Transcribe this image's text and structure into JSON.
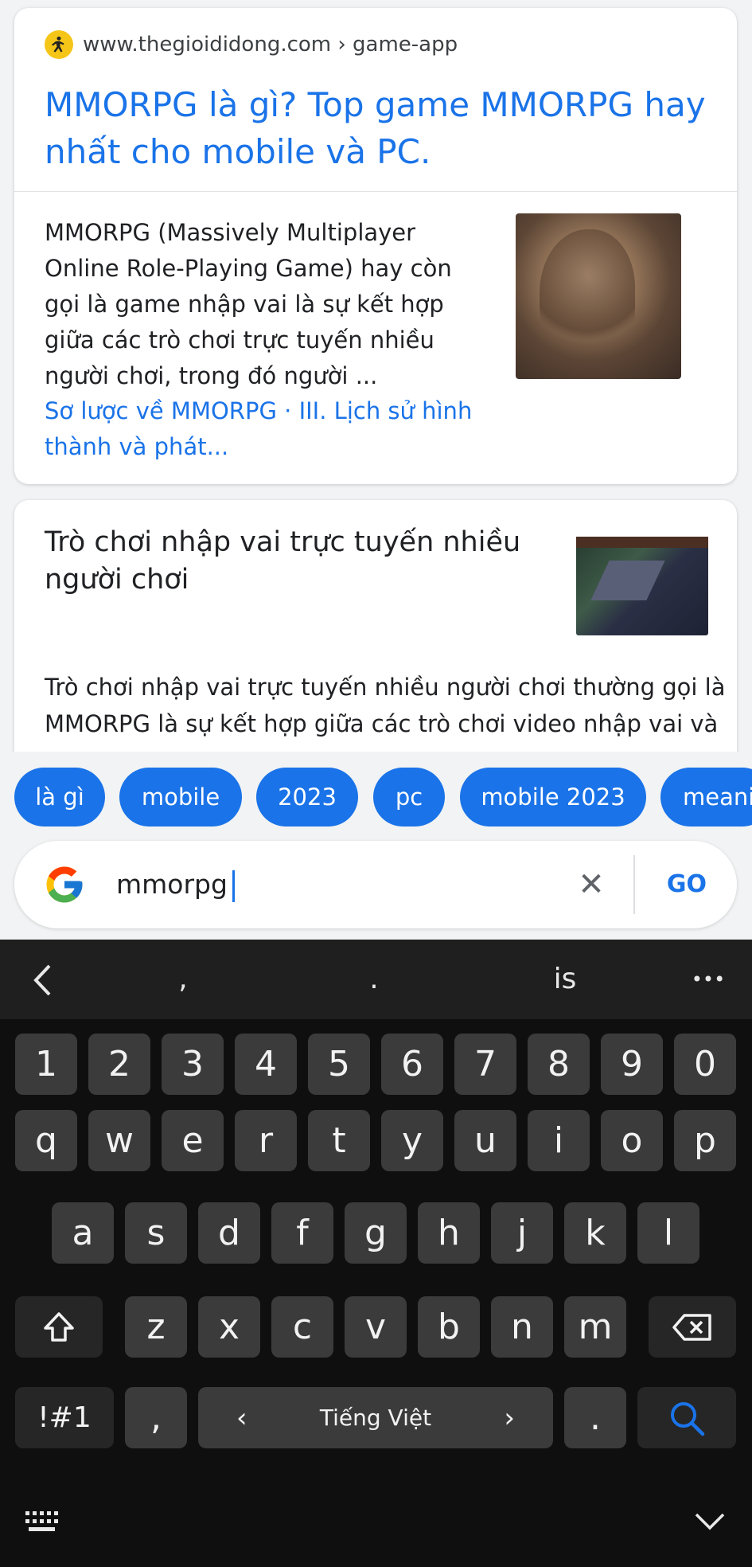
{
  "result1": {
    "site": "www.thegioididong.com › game-app",
    "title": "MMORPG là gì? Top game MMORPG hay nhất cho mobile và PC.",
    "snippet": "MMORPG (Massively Multiplayer Online Role-Playing Game) hay còn gọi là game nhập vai là sự kết hợp giữa các trò chơi trực tuyến nhiều người chơi, trong đó người ...",
    "sitelinks": "Sơ lược về MMORPG · III. Lịch sử hình thành và phát..."
  },
  "result2": {
    "title": "Trò chơi nhập vai trực tuyến nhiều người chơi",
    "snippet": "Trò chơi nhập vai trực tuyến nhiều người chơi thường gọi là MMORPG là sự kết hợp giữa các trò chơi video nhập vai và"
  },
  "chips": [
    "là gì",
    "mobile",
    "2023",
    "pc",
    "mobile 2023",
    "meani"
  ],
  "search": {
    "query": "mmorpg",
    "go_label": "GO",
    "clear_icon": "✕"
  },
  "keyboard": {
    "suggestions": [
      ",",
      ".",
      "is"
    ],
    "more_icon": "•••",
    "row_numbers": [
      "1",
      "2",
      "3",
      "4",
      "5",
      "6",
      "7",
      "8",
      "9",
      "0"
    ],
    "row1": [
      "q",
      "w",
      "e",
      "r",
      "t",
      "y",
      "u",
      "i",
      "o",
      "p"
    ],
    "row2": [
      "a",
      "s",
      "d",
      "f",
      "g",
      "h",
      "j",
      "k",
      "l"
    ],
    "row3": [
      "z",
      "x",
      "c",
      "v",
      "b",
      "n",
      "m"
    ],
    "symbols_key": "!#1",
    "comma_key": ",",
    "space_label": "Tiếng Việt",
    "space_left": "‹",
    "space_right": "›",
    "period_key": "."
  },
  "colors": {
    "accent": "#1a73e8",
    "keyboard_bg": "#0f0f0f",
    "key_bg": "#3b3b3b"
  }
}
